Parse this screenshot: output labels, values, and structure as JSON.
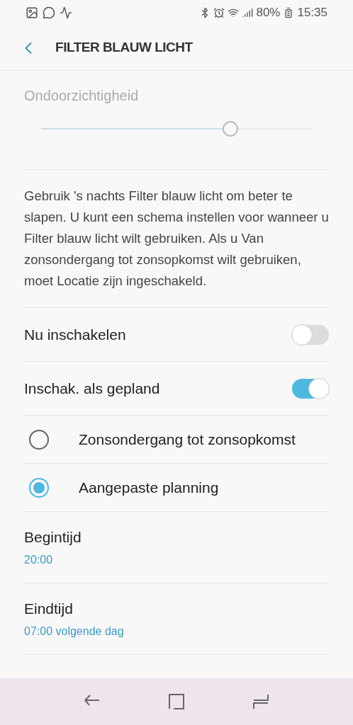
{
  "status_bar": {
    "battery": "80%",
    "time": "15:35"
  },
  "header": {
    "title": "FILTER BLAUW LICHT"
  },
  "opacity": {
    "label": "Ondoorzichtigheid",
    "level": 0.7,
    "disabled": true
  },
  "description": "Gebruik 's nachts Filter blauw licht om beter te slapen. U kunt een schema instellen voor wanneer u Filter blauw licht wilt gebruiken. Als u Van zonsondergang tot zonsopkomst wilt gebruiken, moet Locatie zijn ingeschakeld.",
  "switches": [
    {
      "label": "Nu inschakelen",
      "on": false
    },
    {
      "label": "Inschak. als gepland",
      "on": true
    }
  ],
  "schedule_options": [
    {
      "label": "Zonsondergang tot zonsopkomst",
      "selected": false
    },
    {
      "label": "Aangepaste planning",
      "selected": true
    }
  ],
  "times": [
    {
      "label": "Begintijd",
      "value": "20:00"
    },
    {
      "label": "Eindtijd",
      "value": "07:00 volgende dag"
    }
  ]
}
